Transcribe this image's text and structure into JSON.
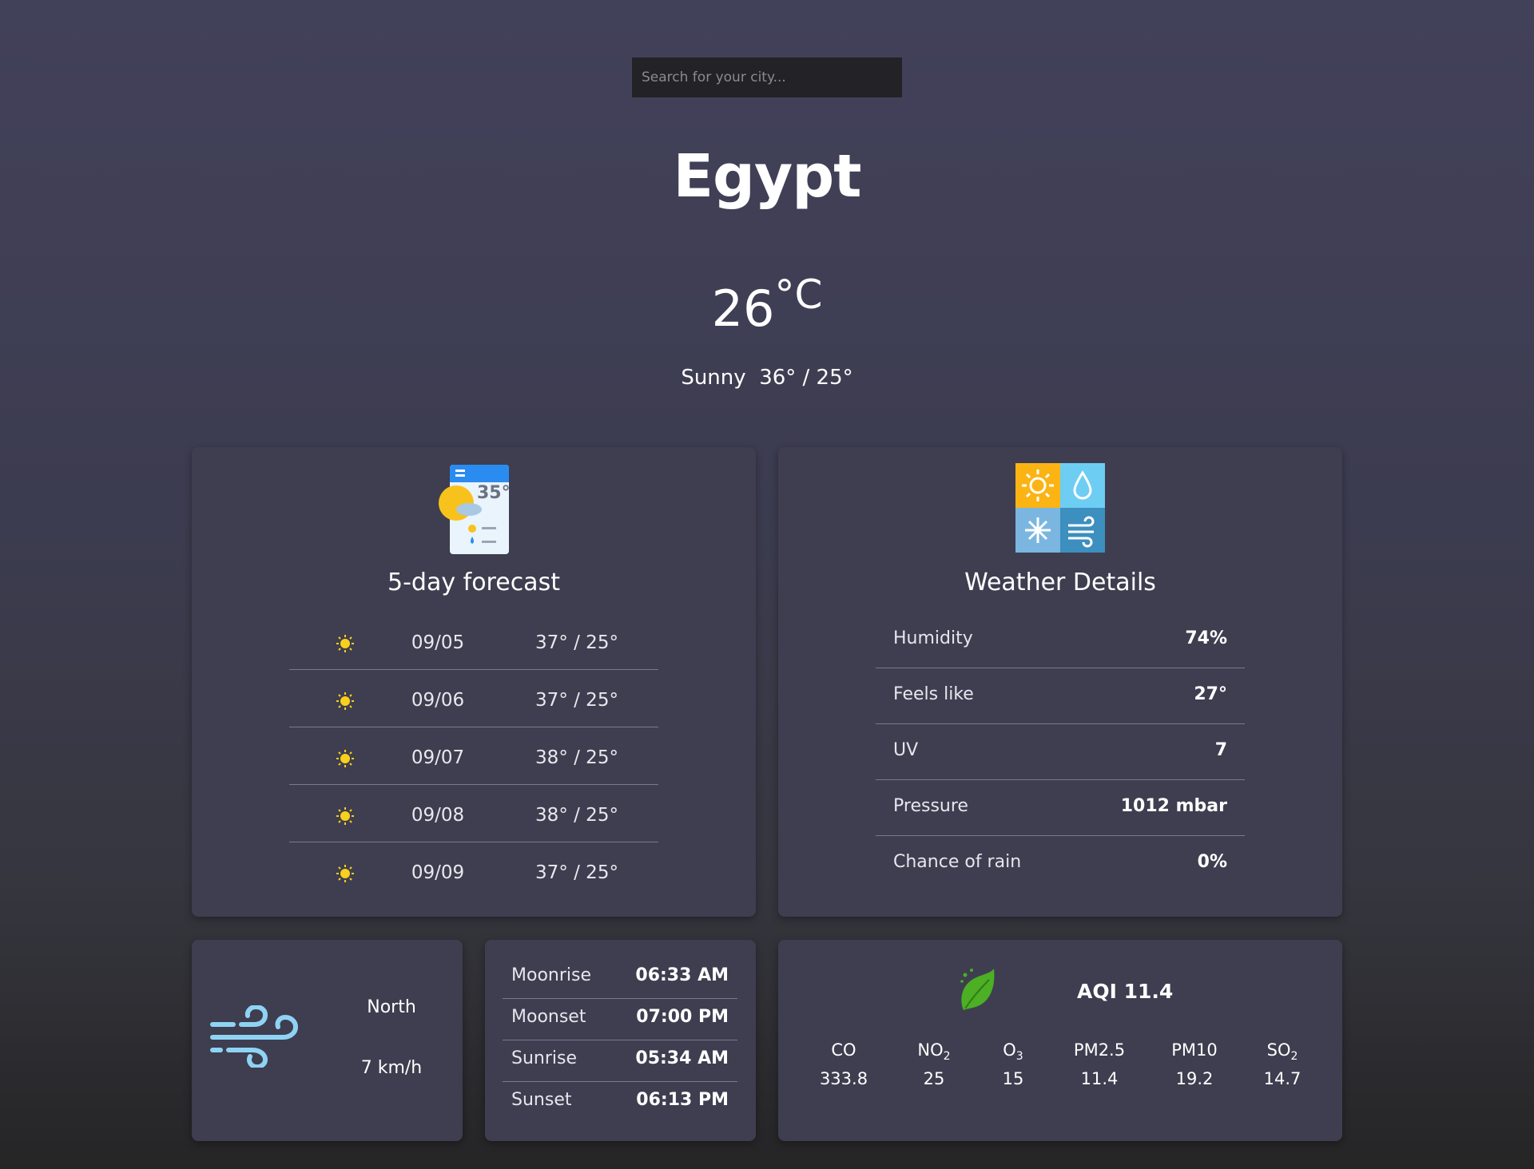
{
  "search": {
    "placeholder": "Search for your city..."
  },
  "location": {
    "city": "Egypt"
  },
  "current": {
    "temp": "26",
    "unit": "°C",
    "condition": "Sunny",
    "high_low": "36° / 25°"
  },
  "forecast": {
    "title": "5-day forecast",
    "icon": "calendar-weather-icon",
    "days": [
      {
        "date": "09/05",
        "range": "37° / 25°",
        "icon": "sun-icon"
      },
      {
        "date": "09/06",
        "range": "37° / 25°",
        "icon": "sun-icon"
      },
      {
        "date": "09/07",
        "range": "38° / 25°",
        "icon": "sun-icon"
      },
      {
        "date": "09/08",
        "range": "38° / 25°",
        "icon": "sun-icon"
      },
      {
        "date": "09/09",
        "range": "37° / 25°",
        "icon": "sun-icon"
      }
    ]
  },
  "details": {
    "title": "Weather Details",
    "icon": "weather-details-icon",
    "rows": [
      {
        "label": "Humidity",
        "value": "74%"
      },
      {
        "label": "Feels like",
        "value": "27°"
      },
      {
        "label": "UV",
        "value": "7"
      },
      {
        "label": "Pressure",
        "value": "1012 mbar"
      },
      {
        "label": "Chance of rain",
        "value": "0%"
      }
    ]
  },
  "wind": {
    "icon": "wind-icon",
    "direction": "North",
    "speed": "7 km/h"
  },
  "astro": {
    "rows": [
      {
        "label": "Moonrise",
        "value": "06:33 AM"
      },
      {
        "label": "Moonset",
        "value": "07:00 PM"
      },
      {
        "label": "Sunrise",
        "value": "05:34 AM"
      },
      {
        "label": "Sunset",
        "value": "06:13 PM"
      }
    ]
  },
  "aqi": {
    "icon": "leaf-icon",
    "title": "AQI 11.4",
    "pollutants": [
      {
        "name": "CO",
        "sub": "",
        "value": "333.8"
      },
      {
        "name": "NO",
        "sub": "2",
        "value": "25"
      },
      {
        "name": "O",
        "sub": "3",
        "value": "15"
      },
      {
        "name": "PM2.5",
        "sub": "",
        "value": "11.4"
      },
      {
        "name": "PM10",
        "sub": "",
        "value": "19.2"
      },
      {
        "name": "SO",
        "sub": "2",
        "value": "14.7"
      }
    ]
  },
  "colors": {
    "sun": "#f9d01c",
    "card": "#3e3e50",
    "divider": "#7a7a8c"
  }
}
